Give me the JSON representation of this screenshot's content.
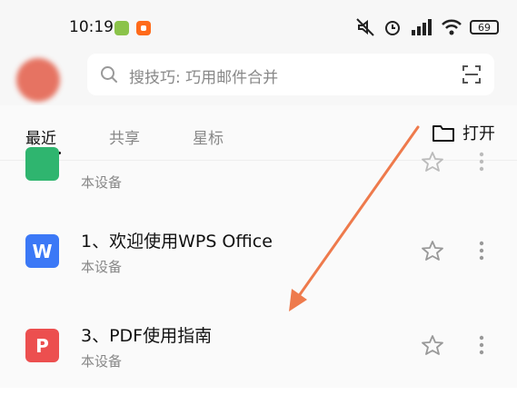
{
  "status_bar": {
    "time": "10:19",
    "battery": "69"
  },
  "search": {
    "placeholder": "搜技巧: 巧用邮件合并"
  },
  "tabs": [
    {
      "label": "最近"
    },
    {
      "label": "共享"
    },
    {
      "label": "星标"
    }
  ],
  "open_button": {
    "label": "打开"
  },
  "files": [
    {
      "title": "",
      "subtitle": "本设备",
      "icon_color": "#2fb56f"
    },
    {
      "title": "1、欢迎使用WPS Office",
      "subtitle": "本设备",
      "icon_color": "#3b78f6",
      "icon": "W"
    },
    {
      "title": "3、PDF使用指南",
      "subtitle": "本设备",
      "icon_color": "#ec4f4f",
      "icon": "P"
    }
  ],
  "colors": {
    "arrow": "#ee7a4c",
    "accent": "#111111"
  }
}
